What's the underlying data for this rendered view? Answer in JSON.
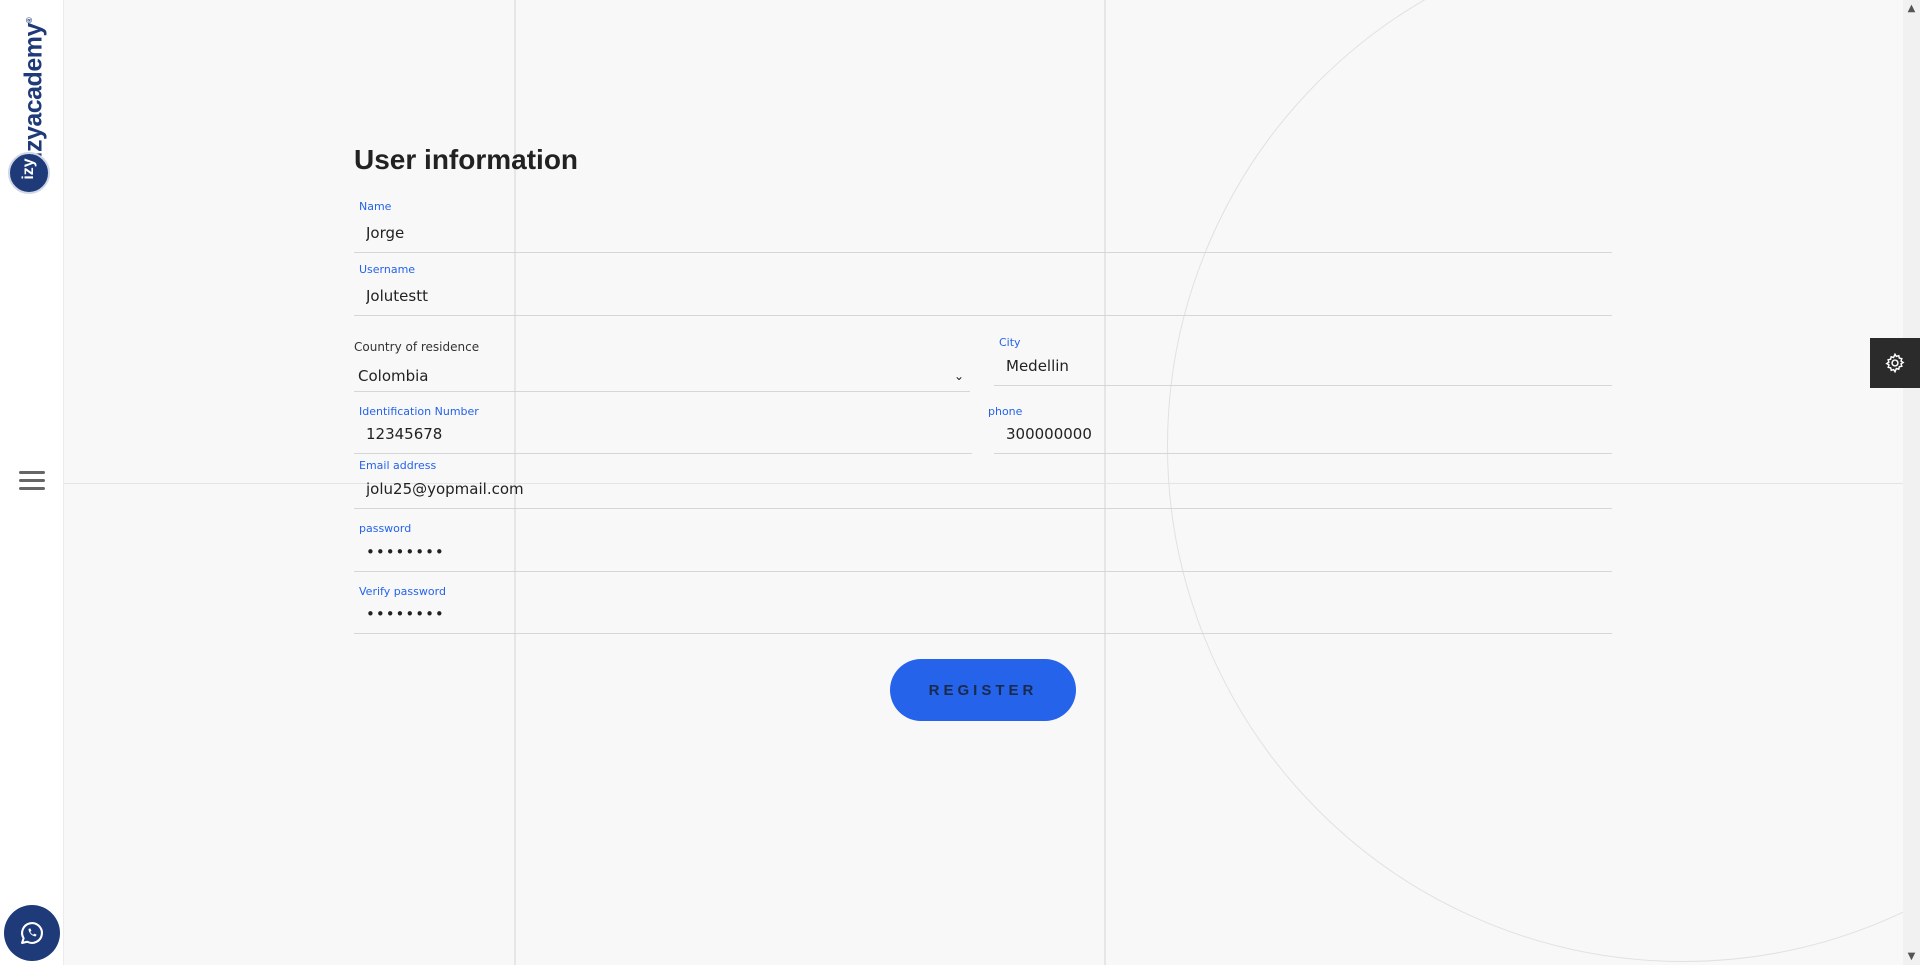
{
  "sidebar": {
    "logo_text": "izyacademy",
    "logo_badge": "izy"
  },
  "form": {
    "title": "User information",
    "name": {
      "label": "Name",
      "value": "Jorge"
    },
    "username": {
      "label": "Username",
      "value": "Jolutestt"
    },
    "country": {
      "label": "Country of residence",
      "value": "Colombia"
    },
    "city": {
      "label": "City",
      "value": "Medellin"
    },
    "id_number": {
      "label": "Identification Number",
      "value": "12345678"
    },
    "phone": {
      "label": "phone",
      "value": "300000000"
    },
    "email": {
      "label": "Email address",
      "value": "jolu25@yopmail.com"
    },
    "password": {
      "label": "password",
      "value": "••••••••"
    },
    "verify_password": {
      "label": "Verify password",
      "value": "••••••••"
    },
    "register_label": "REGISTER"
  },
  "colors": {
    "accent": "#2563eb",
    "brand": "#1e3a78",
    "settings_bg": "#2b2b2b"
  },
  "icons": [
    "izyacademy-logo",
    "menu-icon",
    "whatsapp-icon",
    "gear-icon",
    "scroll-up-icon",
    "scroll-down-icon",
    "chevron-down-icon"
  ]
}
